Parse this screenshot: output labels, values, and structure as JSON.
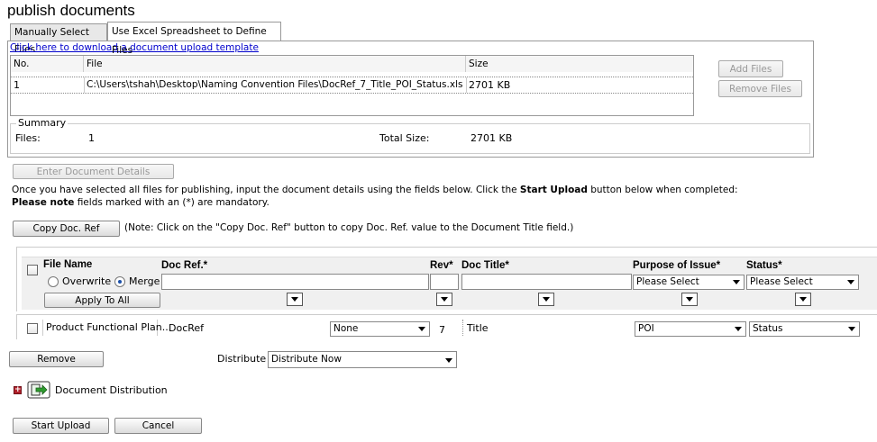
{
  "page": {
    "title": "publish documents"
  },
  "tabs": [
    {
      "label": "Manually Select Files"
    },
    {
      "label": "Use Excel Spreadsheet to Define Files"
    }
  ],
  "template_link": "Click here to download a document upload template",
  "file_table": {
    "columns": [
      "No.",
      "File",
      "Size"
    ],
    "rows": [
      {
        "no": "1",
        "file": "C:\\Users\\tshah\\Desktop\\Naming Convention Files\\DocRef_7_Title_POI_Status.xls",
        "size": "2701 KB"
      }
    ]
  },
  "file_buttons": {
    "add": "Add Files",
    "remove": "Remove Files"
  },
  "summary": {
    "legend": "Summary",
    "files_label": "Files:",
    "files_value": "1",
    "total_label": "Total Size:",
    "total_value": "2701 KB"
  },
  "enter_details_button": "Enter Document Details",
  "instructions": {
    "line1_pre": "Once you have selected all files for publishing, input the document details using the fields below. Click the ",
    "line1_bold": "Start Upload",
    "line1_post": " button below when completed:",
    "line2_bold": "Please note",
    "line2_post": " fields marked with an (*) are mandatory."
  },
  "copy_ref": {
    "button": "Copy Doc. Ref",
    "note": "(Note: Click on the \"Copy Doc. Ref\" button to copy Doc. Ref. value to the Document Title field.)"
  },
  "details": {
    "headers": {
      "file_name": "File Name",
      "doc_ref": "Doc Ref.*",
      "rev": "Rev*",
      "doc_title": "Doc Title*",
      "purpose": "Purpose of Issue*",
      "status": "Status*"
    },
    "mode": {
      "overwrite": "Overwrite",
      "merge": "Merge",
      "selected": "Merge"
    },
    "apply_all": "Apply To All",
    "purpose_select": "Please Select",
    "status_select": "Please Select",
    "row": {
      "file_name": "Product Functional Plan...",
      "doc_ref": "DocRef",
      "doc_ref_option": "None",
      "rev": "7",
      "title": "Title",
      "purpose": "POI",
      "status": "Status"
    }
  },
  "remove_button": "Remove",
  "distribute": {
    "label": "Distribute :",
    "value": "Distribute Now"
  },
  "distribution": {
    "label": "Document Distribution"
  },
  "footer": {
    "start_upload": "Start Upload",
    "cancel": "Cancel"
  }
}
